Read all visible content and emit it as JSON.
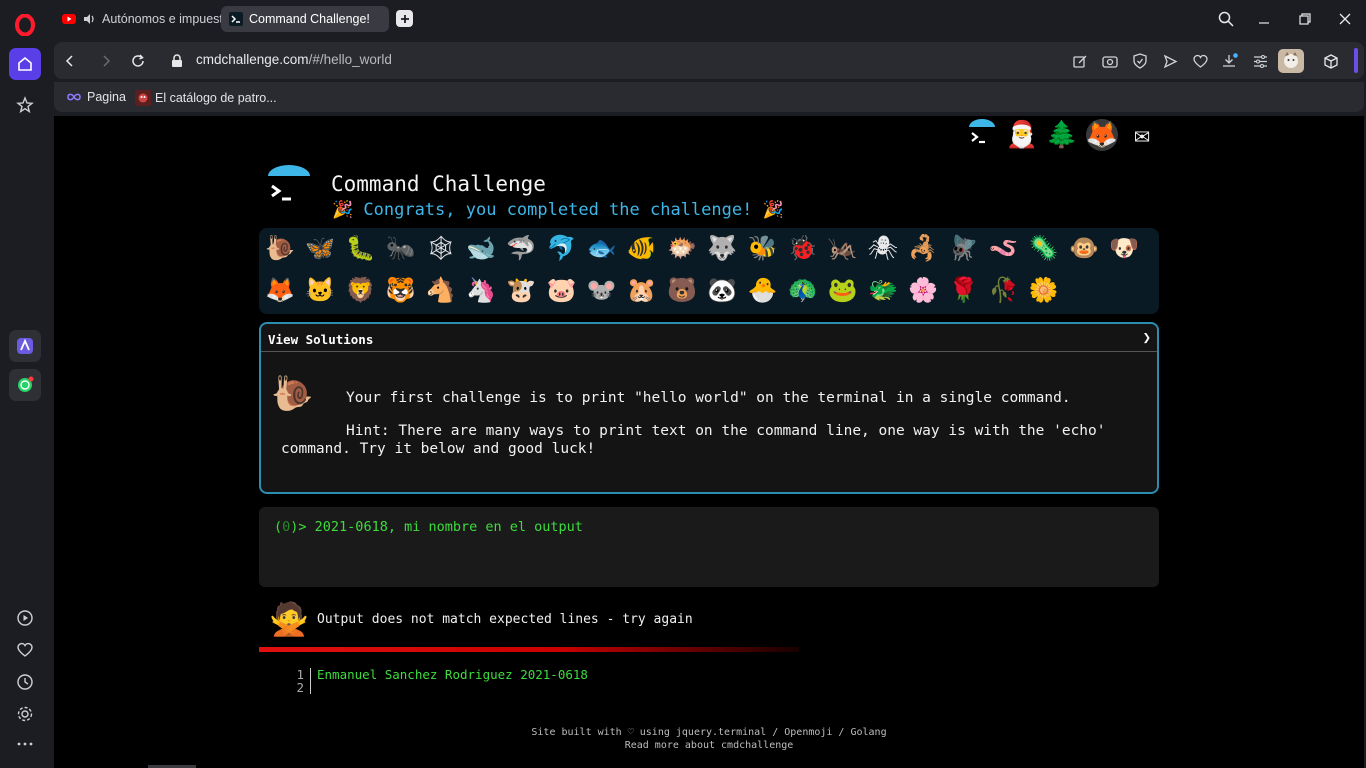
{
  "browser": {
    "tabs": [
      {
        "label": "Autónomos e impuest"
      },
      {
        "label": "Command Challenge!"
      }
    ],
    "url_host": "cmdchallenge.com",
    "url_path": "/#/hello_world",
    "bookmarks": [
      {
        "label": "Pagina"
      },
      {
        "label": "El catálogo de patro..."
      }
    ]
  },
  "page": {
    "title": "Command Challenge",
    "congrats": "🎉 Congrats, you completed the challenge! 🎉",
    "top_icons": [
      "🎅",
      "🌲",
      "🦊",
      "✉"
    ],
    "animals": [
      "🐌",
      "🦋",
      "🐛",
      "🐜",
      "🕸",
      "🐋",
      "🦈",
      "🐬",
      "🐟",
      "🐠",
      "🐡",
      "🐺",
      "🐝",
      "🐞",
      "🦗",
      "🕷",
      "🦂",
      "🪰",
      "🪱",
      "🦠",
      "🐵",
      "🐶",
      "🦊",
      "🐱",
      "🦁",
      "🐯",
      "🐴",
      "🦄",
      "🐮",
      "🐷",
      "🐭",
      "🐹",
      "🐻",
      "🐼",
      "🐣",
      "🦚",
      "🐸",
      "🐲",
      "🌸",
      "🌹",
      "🥀",
      "🌼"
    ],
    "view_solutions": "View Solutions",
    "challenge": "Your first challenge is to print \"hello world\" on the terminal in a single command.",
    "hint": "Hint: There are many ways to print text on the command line, one way is with the 'echo' command. Try it below and good luck!",
    "terminal": {
      "prompt_number": "0",
      "input": "2021-0618, mi nombre en el output"
    },
    "result": "Output does not match expected lines - try again",
    "output_lines": [
      {
        "n": "1",
        "text": "Enmanuel Sanchez Rodriguez 2021-0618"
      },
      {
        "n": "2",
        "text": ""
      }
    ],
    "footer_line1": "Site built with ♡ using jquery.terminal / Openmoji / Golang",
    "footer_line2": "Read more about cmdchallenge"
  },
  "colors": {
    "accent_blue": "#3fb6e8",
    "terminal_green": "#3ddc3d",
    "error_red": "#e01010",
    "opera_red": "#ff1b2d"
  }
}
